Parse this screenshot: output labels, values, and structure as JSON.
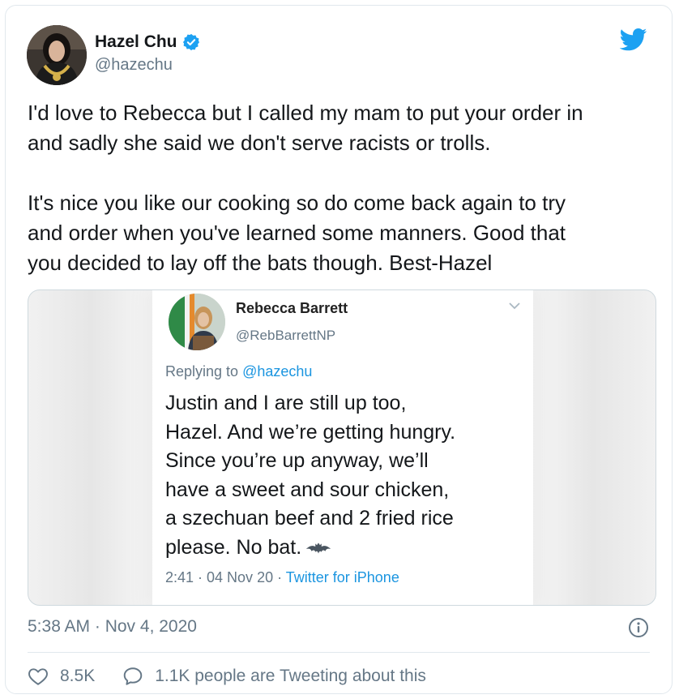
{
  "tweet": {
    "author_name": "Hazel Chu",
    "author_handle": "@hazechu",
    "verified_icon": "verified-badge-icon",
    "platform_icon": "twitter-bird-icon",
    "text": "I'd love to Rebecca but I called my mam to put your order in\nand sadly she said we don't serve racists or trolls.\n\nIt's nice you like our cooking so do come back again to try\nand order when you've learned some manners. Good that\nyou decided to lay off the bats though. Best-Hazel",
    "timestamp": "5:38 AM · Nov 4, 2020",
    "likes": "8.5K",
    "conversation": "1.1K people are Tweeting about this"
  },
  "embedded": {
    "author_name": "Rebecca Barrett",
    "author_handle": "@RebBarrettNP",
    "replying_prefix": "Replying to ",
    "replying_to": "@hazechu",
    "text": "Justin and I are still up too,\nHazel. And we’re getting hungry.\nSince you’re up anyway, we’ll\nhave a sweet and sour chicken,\na szechuan beef and 2 fried rice\nplease. No bat.",
    "time_prefix": "2:41 · 04 Nov 20 · ",
    "source": "Twitter for iPhone"
  },
  "colors": {
    "accent": "#1da1f2",
    "link": "#1b95e0",
    "muted": "#657786",
    "text": "#14171a",
    "border": "#e1e8ed"
  }
}
